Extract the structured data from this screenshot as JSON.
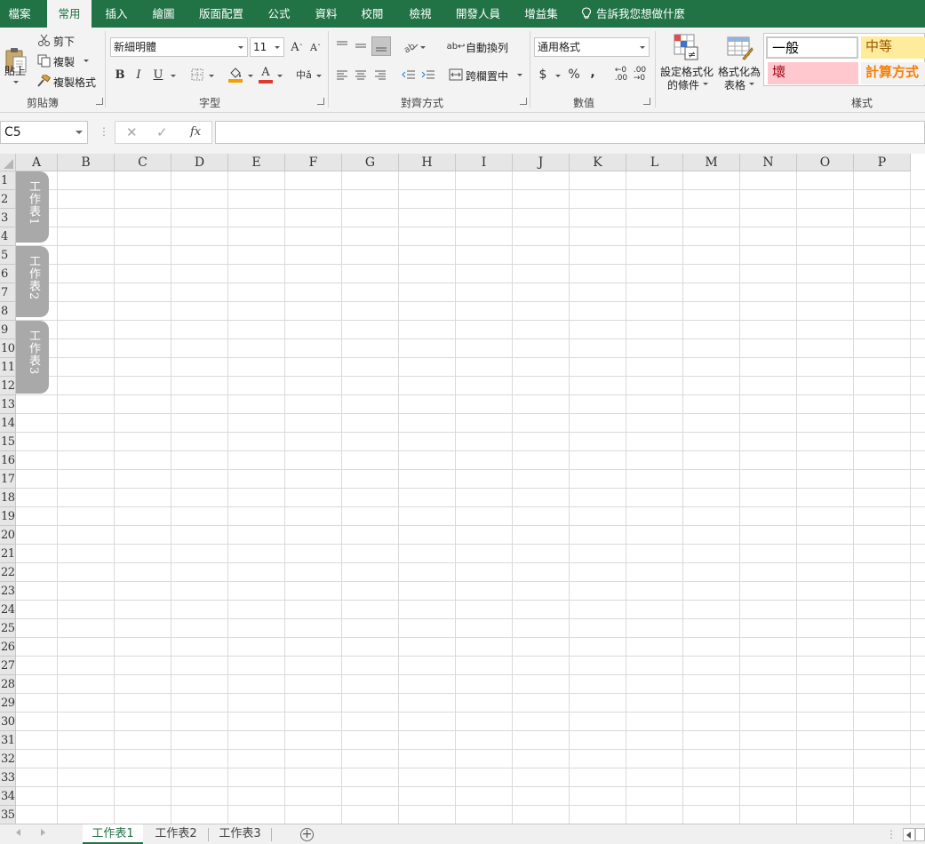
{
  "ribbon_tabs": [
    {
      "label": "檔案",
      "active": false
    },
    {
      "label": "常用",
      "active": true
    },
    {
      "label": "插入",
      "active": false
    },
    {
      "label": "繪圖",
      "active": false
    },
    {
      "label": "版面配置",
      "active": false
    },
    {
      "label": "公式",
      "active": false
    },
    {
      "label": "資料",
      "active": false
    },
    {
      "label": "校閱",
      "active": false
    },
    {
      "label": "檢視",
      "active": false
    },
    {
      "label": "開發人員",
      "active": false
    },
    {
      "label": "增益集",
      "active": false
    }
  ],
  "tell_me": "告訴我您想做什麼",
  "clipboard": {
    "paste": "貼上",
    "cut": "剪下",
    "copy": "複製",
    "format_painter": "複製格式",
    "group_label": "剪貼簿"
  },
  "font": {
    "name": "新細明體",
    "size": "11",
    "bold": "B",
    "italic": "I",
    "underline": "U",
    "group_label": "字型"
  },
  "alignment": {
    "wrap_text": "自動換列",
    "merge_center": "跨欄置中",
    "group_label": "對齊方式"
  },
  "number": {
    "format": "通用格式",
    "currency": "$",
    "percent": "%",
    "comma": ",",
    "group_label": "數值"
  },
  "styles": {
    "conditional_line1": "設定格式化",
    "conditional_line2": "的條件",
    "format_table_line1": "格式化為",
    "format_table_line2": "表格",
    "cell_styles": [
      {
        "label": "一般",
        "bg": "#ffffff",
        "color": "#000000"
      },
      {
        "label": "中等",
        "bg": "#ffeb9c",
        "color": "#9c5700"
      },
      {
        "label": "壞",
        "bg": "#ffc7ce",
        "color": "#9c0006"
      },
      {
        "label": "計算方式",
        "bg": "#f2f2f2",
        "color": "#fa7d00"
      }
    ],
    "group_label": "樣式"
  },
  "formula_bar": {
    "name_box": "C5",
    "fx": "fx",
    "formula": ""
  },
  "columns": [
    "A",
    "B",
    "C",
    "D",
    "E",
    "F",
    "G",
    "H",
    "I",
    "J",
    "K",
    "L",
    "M",
    "N",
    "O",
    "P"
  ],
  "rows": [
    "1",
    "2",
    "3",
    "4",
    "5",
    "6",
    "7",
    "8",
    "9",
    "10",
    "11",
    "12",
    "13",
    "14",
    "15",
    "16",
    "17",
    "18",
    "19",
    "20",
    "21",
    "22",
    "23",
    "24",
    "25",
    "26",
    "27",
    "28",
    "29",
    "30",
    "31",
    "32",
    "33",
    "34",
    "35"
  ],
  "vertical_tabs": [
    "工作表1",
    "工作表2",
    "工作表3"
  ],
  "sheet_tabs": [
    {
      "label": "工作表1",
      "active": true
    },
    {
      "label": "工作表2",
      "active": false
    },
    {
      "label": "工作表3",
      "active": false
    }
  ],
  "colors": {
    "accent": "#217346",
    "ribbon_bg": "#f3f3f3",
    "vertical_tab": "#a9a9a9"
  }
}
